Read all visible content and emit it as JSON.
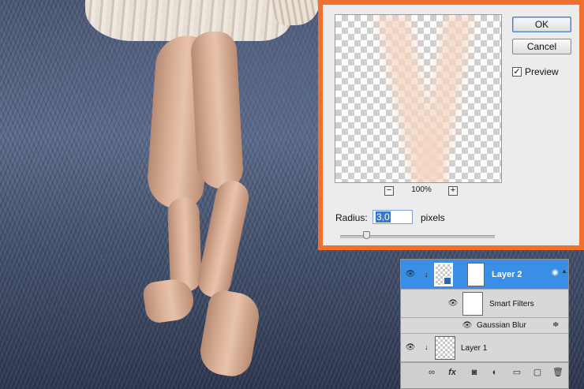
{
  "dialog": {
    "ok_label": "OK",
    "cancel_label": "Cancel",
    "preview_label": "Preview",
    "preview_checked": true,
    "zoom_out_label": "−",
    "zoom_in_label": "+",
    "zoom_level": "100%",
    "radius_label": "Radius:",
    "radius_value": "3,0",
    "radius_unit": "pixels",
    "accent_color": "#f0702e"
  },
  "layers": {
    "rows": [
      {
        "name": "Layer 2",
        "selected": true
      },
      {
        "name": "Smart Filters"
      },
      {
        "name": "Gaussian Blur"
      },
      {
        "name": "Layer 1"
      }
    ],
    "selection_color": "#3a8ee6"
  },
  "icons": {
    "eye": "eye-icon",
    "link": "link-icon",
    "fx": "fx",
    "mask": "mask-icon",
    "adjustment": "adjustment-icon",
    "group": "folder-icon",
    "new_layer": "new-layer-icon",
    "delete": "trash-icon"
  }
}
